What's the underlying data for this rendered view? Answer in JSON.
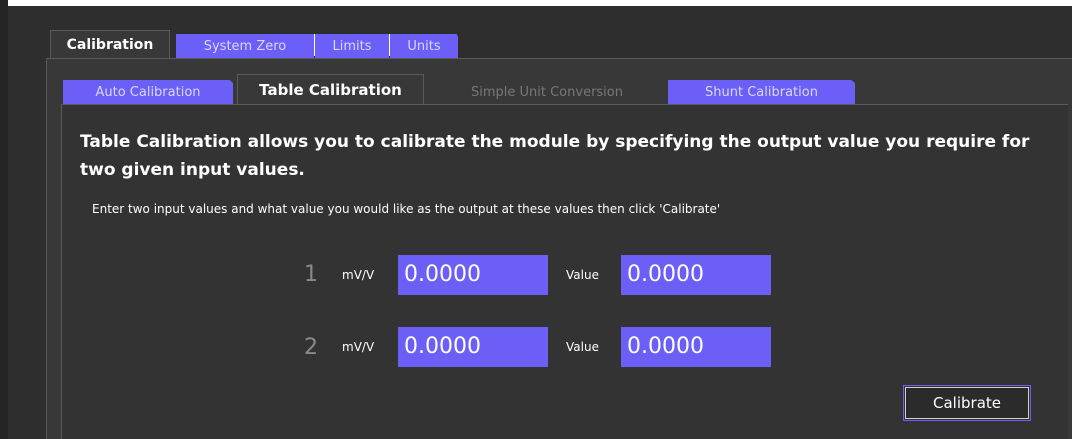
{
  "main_tabs": [
    {
      "label": "Calibration",
      "state": "active"
    },
    {
      "label": "System Zero",
      "state": "inactive"
    },
    {
      "label": "Limits",
      "state": "inactive"
    },
    {
      "label": "Units",
      "state": "inactive"
    }
  ],
  "sub_tabs": [
    {
      "label": "Auto Calibration",
      "state": "inactive"
    },
    {
      "label": "Table Calibration",
      "state": "active"
    },
    {
      "label": "Simple Unit Conversion",
      "state": "disabled"
    },
    {
      "label": "Shunt Calibration",
      "state": "inactive"
    }
  ],
  "content": {
    "description": "Table Calibration allows you to calibrate the module by specifying the output value you require for two given input values.",
    "instructions": "Enter two input values and what value you would like as the output at these values then click 'Calibrate'"
  },
  "rows": [
    {
      "number": "1",
      "input_label": "mV/V",
      "input_value": "0.0000",
      "output_label": "Value",
      "output_value": "0.0000"
    },
    {
      "number": "2",
      "input_label": "mV/V",
      "input_value": "0.0000",
      "output_label": "Value",
      "output_value": "0.0000"
    }
  ],
  "calibrate_button": {
    "label": "Calibrate"
  },
  "colors": {
    "accent": "#6b5ff7",
    "pane": "#383838",
    "background": "#2e2e2e",
    "text": "#ffffff",
    "disabled_text": "#777777"
  }
}
